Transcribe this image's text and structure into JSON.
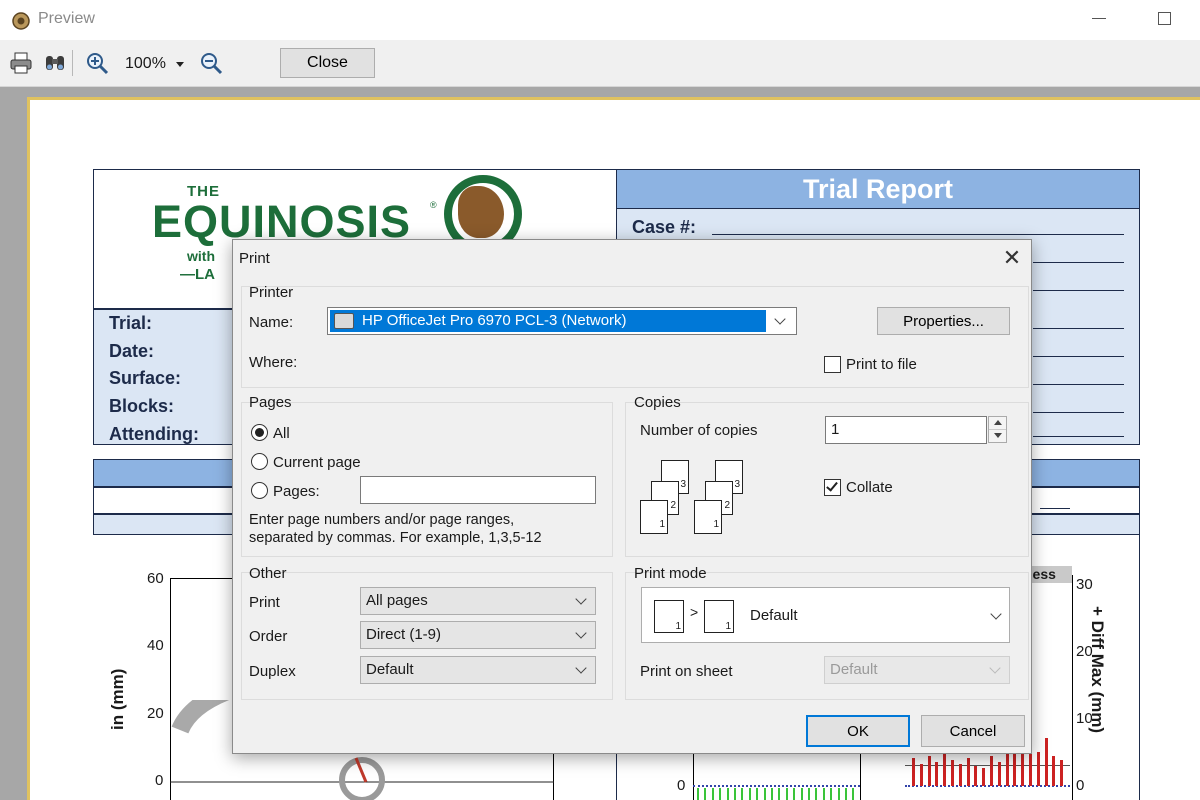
{
  "window": {
    "title": "Preview"
  },
  "toolbar": {
    "zoom": "100%",
    "close_label": "Close"
  },
  "document": {
    "logo_the": "THE",
    "logo_main": "EQUINOSIS",
    "logo_reg": "®",
    "logo_with": "with",
    "logo_la": "—LA",
    "header_title": "Trial Report",
    "case_label": "Case #:",
    "info_labels": [
      "Trial:",
      "Date:",
      "Surface:",
      "Blocks:",
      "Attending:"
    ],
    "left_chart": {
      "y_ticks": [
        "60",
        "40",
        "20",
        "0"
      ],
      "y_label": "in (mm)"
    },
    "right_chart": {
      "label": "ness",
      "y_ticks": [
        "30",
        "20",
        "10",
        "0"
      ],
      "y_label": "+ Diff Max (mm)",
      "left_tick": "0"
    }
  },
  "dialog": {
    "title": "Print",
    "close_glyph": "✕",
    "printer": {
      "group_label": "Printer",
      "name_label": "Name:",
      "name_value": "HP OfficeJet Pro 6970 PCL-3 (Network)",
      "where_label": "Where:",
      "properties_label": "Properties...",
      "print_to_file_label": "Print to file",
      "print_to_file_checked": false
    },
    "pages": {
      "group_label": "Pages",
      "all_label": "All",
      "current_label": "Current page",
      "pages_label": "Pages:",
      "pages_value": "",
      "selected": "All",
      "hint_line1": "Enter page numbers and/or page ranges,",
      "hint_line2": "separated by commas. For example, 1,3,5-12"
    },
    "copies": {
      "group_label": "Copies",
      "number_label": "Number of copies",
      "number_value": "1",
      "collate_label": "Collate",
      "collate_checked": true,
      "collate_icon_numbers": [
        "3",
        "2",
        "1"
      ]
    },
    "other": {
      "group_label": "Other",
      "print_label": "Print",
      "print_value": "All pages",
      "order_label": "Order",
      "order_value": "Direct (1-9)",
      "duplex_label": "Duplex",
      "duplex_value": "Default"
    },
    "print_mode": {
      "group_label": "Print mode",
      "mode_value": "Default",
      "mode_page_number": "1",
      "print_on_sheet_label": "Print on sheet",
      "print_on_sheet_value": "Default"
    },
    "buttons": {
      "ok": "OK",
      "cancel": "Cancel"
    }
  },
  "colors": {
    "accent": "#0078d7",
    "doc_header_blue": "#8db3e2",
    "doc_light_blue": "#dbe6f4",
    "logo_green": "#1d6e3a",
    "bar_red": "#cc2222",
    "bar_green": "#3ac43a"
  }
}
